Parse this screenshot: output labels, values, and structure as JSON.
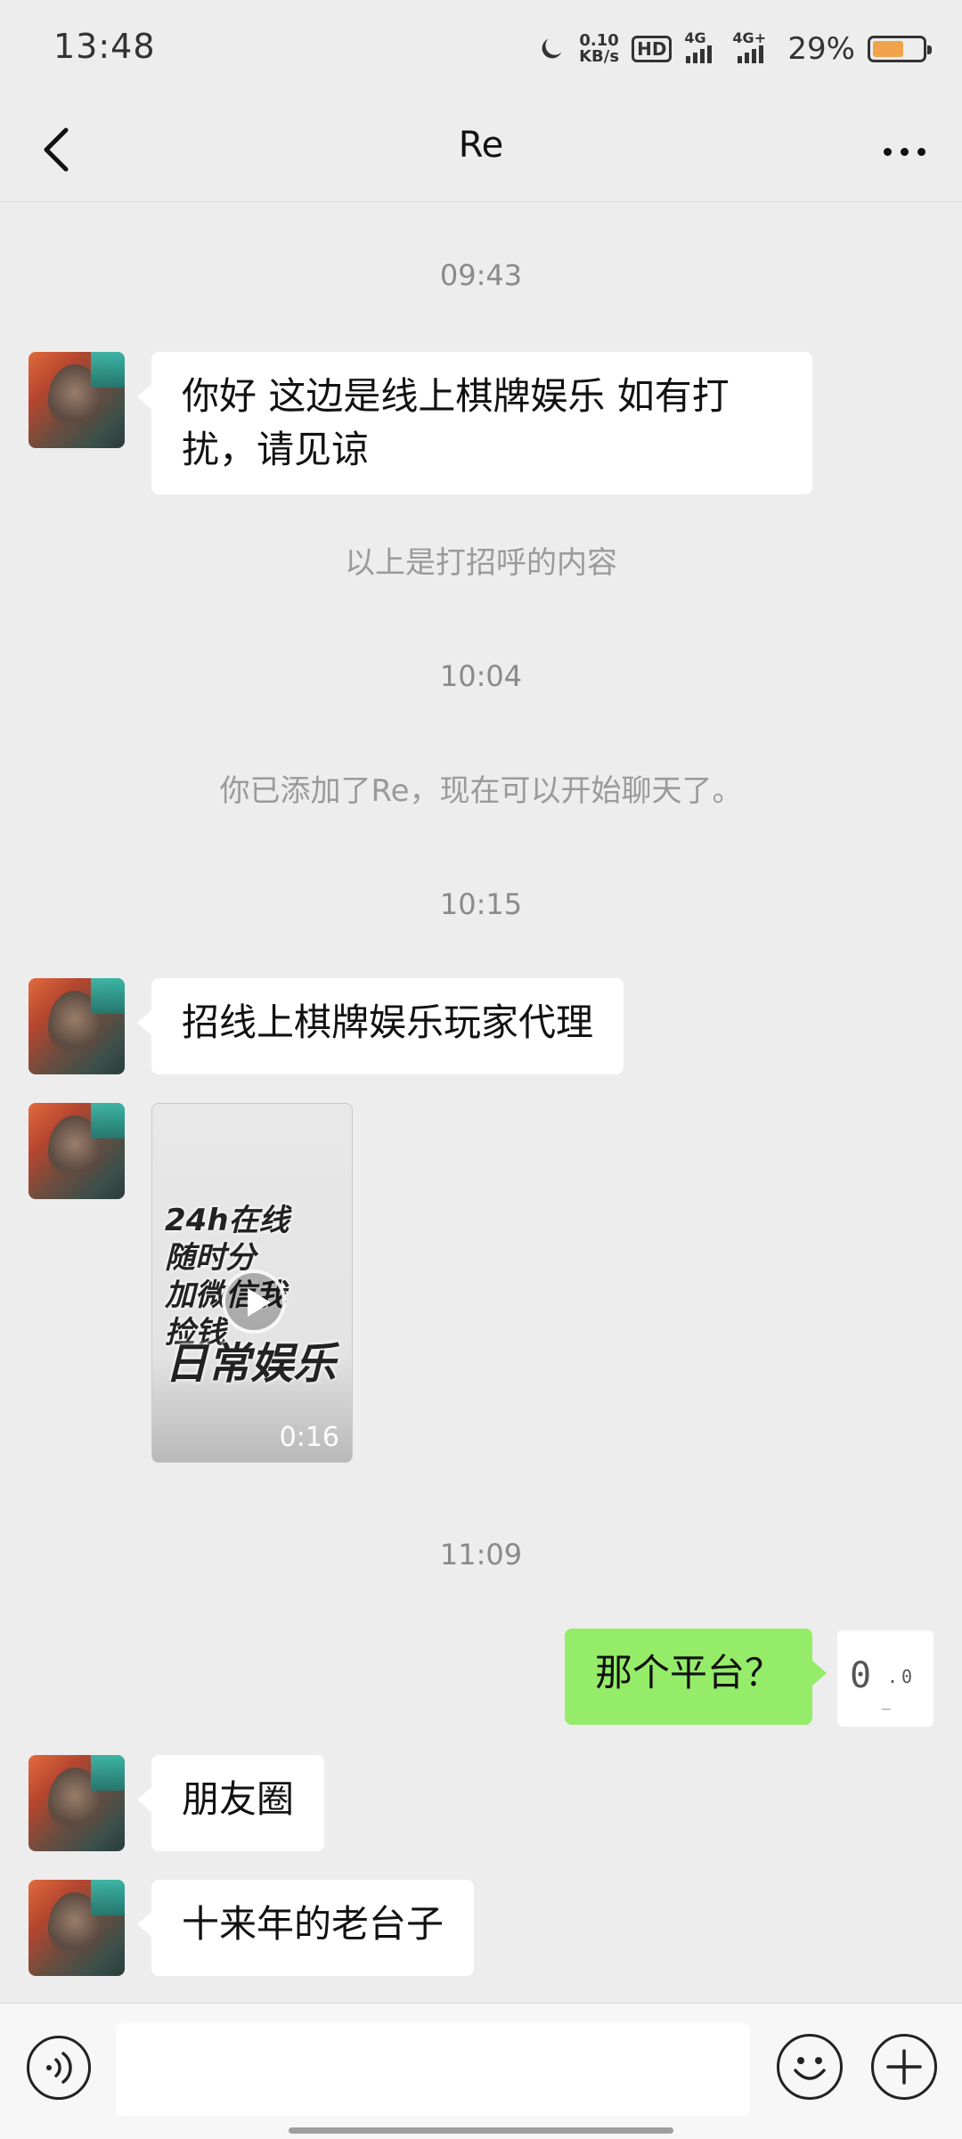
{
  "status_bar": {
    "time": "13:48",
    "net_speed_value": "0.10",
    "net_speed_unit": "KB/s",
    "hd_label": "HD",
    "signal1_label": "4G",
    "signal2_label": "4G+",
    "battery_percent": "29%",
    "battery_level": 0.29,
    "icons": [
      "moon-icon",
      "hd-icon",
      "signal-icon",
      "signal-icon",
      "battery-icon"
    ]
  },
  "header": {
    "title": "Re",
    "back_icon": "chevron-left-icon",
    "more_icon": "more-icon"
  },
  "messages": {
    "ts1": "09:43",
    "greeting": "你好  这边是线上棋牌娱乐  如有打扰，请见谅",
    "greeting_note": "以上是打招呼的内容",
    "ts2": "10:04",
    "added_notice": "你已添加了Re，现在可以开始聊天了。",
    "ts3": "10:15",
    "msg_agent": "招线上棋牌娱乐玩家代理",
    "video": {
      "line1": "24h在线",
      "line2": "随时分",
      "line3": "加微信我",
      "line4": "捡钱",
      "line5": "日常娱乐",
      "duration": "0:16"
    },
    "ts4": "11:09",
    "my_question": "那个平台？",
    "reply1": "朋友圈",
    "reply2": "十来年的老台子"
  },
  "input_bar": {
    "voice_icon": "voice-icon",
    "emoji_icon": "emoji-icon",
    "plus_icon": "plus-icon"
  },
  "colors": {
    "background": "#ededed",
    "my_bubble": "#95ec69",
    "other_bubble": "#ffffff"
  }
}
